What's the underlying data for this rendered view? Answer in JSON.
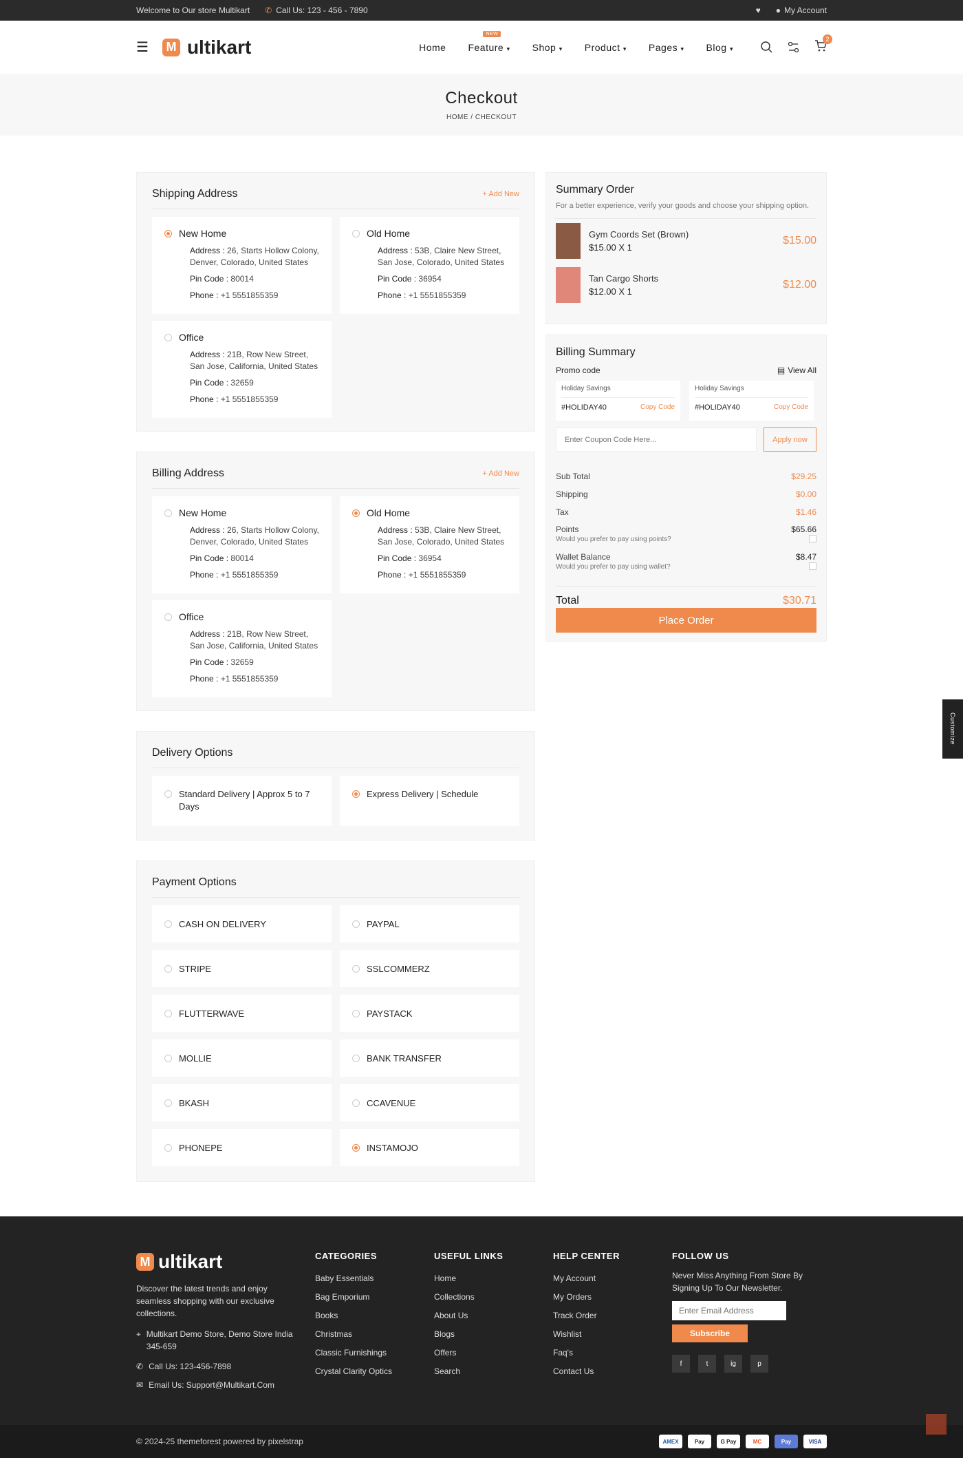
{
  "topbar": {
    "welcome": "Welcome to Our store Multikart",
    "call": "Call Us: 123 - 456 - 7890",
    "account": "My Account"
  },
  "nav": {
    "brand": "ultikart",
    "brand_m": "M",
    "items": [
      "Home",
      "Feature",
      "Shop",
      "Product",
      "Pages",
      "Blog"
    ],
    "new_badge": "NEW",
    "cart_count": "2"
  },
  "banner": {
    "title": "Checkout",
    "crumb_home": "HOME",
    "crumb_sep": "/",
    "crumb_current": "CHECKOUT"
  },
  "shipping": {
    "title": "Shipping Address",
    "add": "+ Add New",
    "cards": [
      {
        "name": "New Home",
        "addr_label": "Address :",
        "addr": "26, Starts Hollow Colony, Denver, Colorado, United States",
        "pin_label": "Pin Code :",
        "pin": "80014",
        "phone_label": "Phone :",
        "phone": "+1 5551855359",
        "selected": true
      },
      {
        "name": "Old Home",
        "addr_label": "Address :",
        "addr": "53B, Claire New Street, San Jose, Colorado, United States",
        "pin_label": "Pin Code :",
        "pin": "36954",
        "phone_label": "Phone :",
        "phone": "+1 5551855359",
        "selected": false
      },
      {
        "name": "Office",
        "addr_label": "Address :",
        "addr": "21B, Row New Street, San Jose, California, United States",
        "pin_label": "Pin Code :",
        "pin": "32659",
        "phone_label": "Phone :",
        "phone": "+1 5551855359",
        "selected": false
      }
    ]
  },
  "billing": {
    "title": "Billing Address",
    "add": "+ Add New",
    "cards": [
      {
        "name": "New Home",
        "addr_label": "Address :",
        "addr": "26, Starts Hollow Colony, Denver, Colorado, United States",
        "pin_label": "Pin Code :",
        "pin": "80014",
        "phone_label": "Phone :",
        "phone": "+1 5551855359",
        "selected": false
      },
      {
        "name": "Old Home",
        "addr_label": "Address :",
        "addr": "53B, Claire New Street, San Jose, Colorado, United States",
        "pin_label": "Pin Code :",
        "pin": "36954",
        "phone_label": "Phone :",
        "phone": "+1 5551855359",
        "selected": true
      },
      {
        "name": "Office",
        "addr_label": "Address :",
        "addr": "21B, Row New Street, San Jose, California, United States",
        "pin_label": "Pin Code :",
        "pin": "32659",
        "phone_label": "Phone :",
        "phone": "+1 5551855359",
        "selected": false
      }
    ]
  },
  "delivery": {
    "title": "Delivery Options",
    "options": [
      "Standard Delivery | Approx 5 to 7 Days",
      "Express Delivery | Schedule"
    ],
    "selected": 1
  },
  "payment": {
    "title": "Payment Options",
    "options": [
      "CASH ON DELIVERY",
      "PAYPAL",
      "STRIPE",
      "SSLCOMMERZ",
      "FLUTTERWAVE",
      "PAYSTACK",
      "MOLLIE",
      "BANK TRANSFER",
      "BKASH",
      "CCAVENUE",
      "PHONEPE",
      "INSTAMOJO"
    ],
    "selected": 11
  },
  "summary": {
    "title": "Summary Order",
    "subtitle": "For a better experience, verify your goods and choose your shipping option.",
    "products": [
      {
        "name": "Gym Coords Set (Brown)",
        "qty": "$15.00 X 1",
        "price": "$15.00"
      },
      {
        "name": "Tan Cargo Shorts",
        "qty": "$12.00 X 1",
        "price": "$12.00"
      }
    ]
  },
  "billing_summary": {
    "title": "Billing Summary",
    "promo_label": "Promo code",
    "view_all": "View All",
    "promos": [
      {
        "name": "Holiday Savings",
        "code": "#HOLIDAY40",
        "copy": "Copy Code"
      },
      {
        "name": "Holiday Savings",
        "code": "#HOLIDAY40",
        "copy": "Copy Code"
      }
    ],
    "coupon_placeholder": "Enter Coupon Code Here...",
    "apply": "Apply now",
    "sub_total_label": "Sub Total",
    "sub_total": "$29.25",
    "shipping_label": "Shipping",
    "shipping": "$0.00",
    "tax_label": "Tax",
    "tax": "$1.46",
    "points_label": "Points",
    "points": "$65.66",
    "points_hint": "Would you prefer to pay using points?",
    "wallet_label": "Wallet Balance",
    "wallet": "$8.47",
    "wallet_hint": "Would you prefer to pay using wallet?",
    "total_label": "Total",
    "total": "$30.71",
    "place_order": "Place Order"
  },
  "customize": "Customize",
  "footer": {
    "brand": "ultikart",
    "brand_m": "M",
    "about": "Discover the latest trends and enjoy seamless shopping with our exclusive collections.",
    "address": "Multikart Demo Store, Demo Store India 345-659",
    "call": "Call Us: 123-456-7898",
    "email": "Email Us: Support@Multikart.Com",
    "cols": [
      {
        "title": "CATEGORIES",
        "items": [
          "Baby Essentials",
          "Bag Emporium",
          "Books",
          "Christmas",
          "Classic Furnishings",
          "Crystal Clarity Optics"
        ]
      },
      {
        "title": "USEFUL LINKS",
        "items": [
          "Home",
          "Collections",
          "About Us",
          "Blogs",
          "Offers",
          "Search"
        ]
      },
      {
        "title": "HELP CENTER",
        "items": [
          "My Account",
          "My Orders",
          "Track Order",
          "Wishlist",
          "Faq's",
          "Contact Us"
        ]
      }
    ],
    "follow_title": "FOLLOW US",
    "follow_text": "Never Miss Anything From Store By Signing Up To Our Newsletter.",
    "email_placeholder": "Enter Email Address",
    "subscribe": "Subscribe",
    "social": [
      "f",
      "t",
      "ig",
      "p"
    ],
    "copyright": "© 2024-25 themeforest powered by pixelstrap",
    "payments": [
      "AMEX",
      "Pay",
      "G Pay",
      "MC",
      "Pay",
      "VISA"
    ]
  }
}
